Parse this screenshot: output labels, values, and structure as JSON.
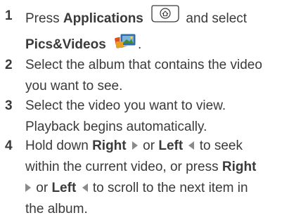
{
  "steps": [
    {
      "number": "1",
      "line1_a": "Press ",
      "line1_bold": "Applications",
      "line1_b": " and select",
      "line2_bold": "Pics&Videos",
      "line2_end": "."
    },
    {
      "number": "2",
      "line1": "Select the album that contains the video",
      "line2": "you want to see."
    },
    {
      "number": "3",
      "line1": "Select the video you want to view.",
      "line2": "Playback begins automatically."
    },
    {
      "number": "4",
      "hold": "Hold down ",
      "right": "Right",
      "or1": " or ",
      "left": "Left",
      "to_seek": " to seek",
      "within": "within the current video, or press ",
      "right2": "Right",
      "or2": " or ",
      "left2": "Left",
      "scroll": " to scroll to the next item in",
      "end": "the album."
    }
  ],
  "icons": {
    "applications": "applications-key-icon",
    "pics_videos": "pics-videos-app-icon",
    "right": "right-arrow-icon",
    "left": "left-arrow-icon"
  },
  "colors": {
    "text": "#3a3a3a",
    "arrow": "#8a8a8a"
  }
}
